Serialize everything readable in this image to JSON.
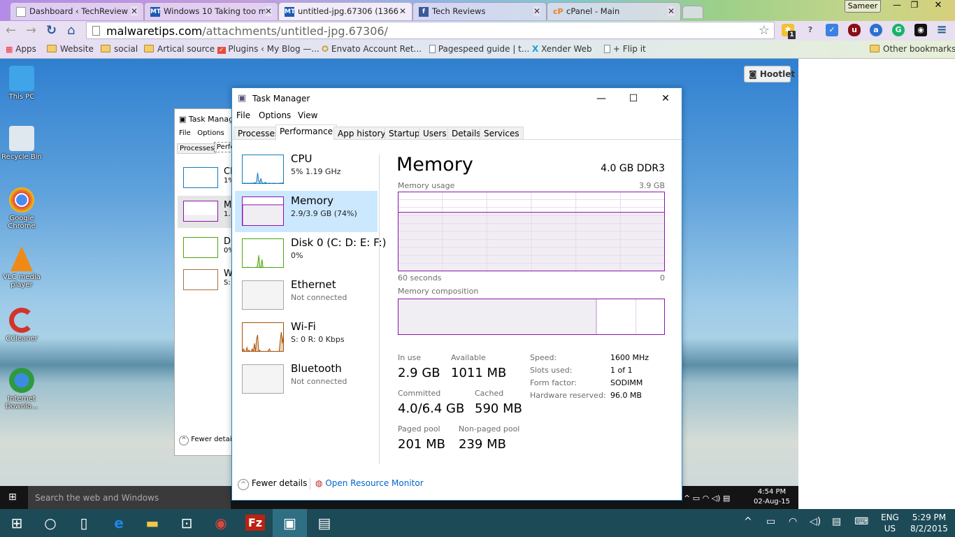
{
  "browser": {
    "tabs": [
      {
        "title": "Dashboard ‹ TechReview",
        "icon": "page-icon"
      },
      {
        "title": "Windows 10 Taking too m",
        "icon": "mt-icon",
        "favicon_text": "MT"
      },
      {
        "title": "untitled-jpg.67306 (1366×",
        "icon": "mt-icon",
        "favicon_text": "MT",
        "active": true
      },
      {
        "title": "Tech Reviews",
        "icon": "facebook-icon",
        "favicon_text": "f"
      },
      {
        "title": "cPanel - Main",
        "icon": "cpanel-icon",
        "favicon_text": "cP"
      }
    ],
    "user": "Sameer",
    "url_host": "malwaretips.com",
    "url_path": "/attachments/untitled-jpg.67306/",
    "extension_badge": "1",
    "bookmarks": [
      {
        "label": "Apps",
        "icon": "apps-grid-icon"
      },
      {
        "label": "Website",
        "icon": "folder-icon"
      },
      {
        "label": "social",
        "icon": "folder-icon"
      },
      {
        "label": "Artical source",
        "icon": "folder-icon"
      },
      {
        "label": "Plugins ‹ My Blog —...",
        "icon": "wordpress-check-icon"
      },
      {
        "label": "Envato Account Ret...",
        "icon": "envato-icon"
      },
      {
        "label": "Pagespeed guide | t...",
        "icon": "page-icon"
      },
      {
        "label": "Xender Web",
        "icon": "xender-icon"
      },
      {
        "label": "+ Flip it",
        "icon": "page-icon"
      }
    ],
    "other_bookmarks": "Other bookmarks"
  },
  "desktop": {
    "icons": [
      {
        "label": "This PC",
        "color": "#3fa4e8"
      },
      {
        "label": "Recycle Bin",
        "color": "#dfe8ef"
      },
      {
        "label": "Google Chrome",
        "color": "#e0443a"
      },
      {
        "label": "VLC media player",
        "color": "#f08a17"
      },
      {
        "label": "CCleaner",
        "color": "#d4332b"
      },
      {
        "label": "Internet Downlo...",
        "color": "#2d9b3d"
      }
    ],
    "hootlet": "Hootlet",
    "inner_search": "Search the web and Windows",
    "inner_time": "4:54 PM",
    "inner_date": "02-Aug-15"
  },
  "bg_task_manager": {
    "title": "Task Manage",
    "menu": [
      "File",
      "Options"
    ],
    "tabs": [
      "Processes",
      "Perfo"
    ],
    "items": [
      {
        "name": "Cl",
        "sub": "1%"
      },
      {
        "name": "M",
        "sub": "1."
      },
      {
        "name": "D",
        "sub": "0%"
      },
      {
        "name": "W",
        "sub": "S:"
      }
    ],
    "fewer": "Fewer detail"
  },
  "task_manager": {
    "title": "Task Manager",
    "menu": [
      "File",
      "Options",
      "View"
    ],
    "tabs": [
      "Processes",
      "Performance",
      "App history",
      "Startup",
      "Users",
      "Details",
      "Services"
    ],
    "active_tab": "Performance",
    "resources": [
      {
        "name": "CPU",
        "sub": "5%  1.19 GHz",
        "color": "#117dbb",
        "history": [
          2,
          2,
          3,
          2,
          2,
          3,
          2,
          2,
          3,
          2,
          3,
          4,
          3,
          8,
          40,
          10,
          4,
          20,
          5,
          3,
          2,
          6,
          3,
          2,
          2,
          3,
          2,
          2,
          2,
          3,
          2,
          2,
          2,
          2,
          2,
          3,
          2,
          4,
          2,
          2
        ]
      },
      {
        "name": "Memory",
        "sub": "2.9/3.9 GB (74%)",
        "color": "#8b12ae",
        "selected": true,
        "history": [
          74,
          74,
          74,
          74,
          74
        ]
      },
      {
        "name": "Disk 0 (C: D: E: F:)",
        "sub": "0%",
        "color": "#4da60c",
        "history": [
          0,
          0,
          2,
          0,
          0,
          3,
          0,
          0,
          0,
          0,
          0,
          0,
          2,
          0,
          10,
          45,
          5,
          0,
          30,
          0,
          0,
          0,
          0,
          0,
          0,
          0,
          2,
          0,
          0,
          0,
          0,
          0,
          0,
          0,
          0,
          0,
          0,
          0,
          0,
          5
        ]
      },
      {
        "name": "Ethernet",
        "sub": "Not connected",
        "color": "#a7a7a7",
        "history": []
      },
      {
        "name": "Wi-Fi",
        "sub": "S: 0  R: 0 Kbps",
        "color": "#a74f01",
        "history": [
          0,
          10,
          0,
          0,
          15,
          0,
          5,
          0,
          0,
          10,
          0,
          30,
          0,
          45,
          60,
          0,
          5,
          0,
          0,
          0,
          0,
          0,
          0,
          0,
          5,
          10,
          0,
          0,
          0,
          0,
          0,
          0,
          0,
          0,
          0,
          40,
          70,
          30,
          60,
          0
        ]
      },
      {
        "name": "Bluetooth",
        "sub": "Not connected",
        "color": "#a7a7a7",
        "history": []
      }
    ],
    "detail": {
      "title": "Memory",
      "spec": "4.0 GB DDR3",
      "usage_label": "Memory usage",
      "usage_max": "3.9 GB",
      "usage_percent": 74,
      "time_left": "60 seconds",
      "time_right": "0",
      "composition_label": "Memory composition",
      "composition_mb": {
        "in_use": 2970,
        "modified": 15,
        "standby": 590,
        "free": 421
      },
      "stats": [
        {
          "label": "In use",
          "value": "2.9 GB"
        },
        {
          "label": "Available",
          "value": "1011 MB"
        },
        {
          "label": "Committed",
          "value": "4.0/6.4 GB"
        },
        {
          "label": "Cached",
          "value": "590 MB"
        },
        {
          "label": "Paged pool",
          "value": "201 MB"
        },
        {
          "label": "Non-paged pool",
          "value": "239 MB"
        }
      ],
      "specs": [
        {
          "key": "Speed:",
          "value": "1600 MHz"
        },
        {
          "key": "Slots used:",
          "value": "1 of 1"
        },
        {
          "key": "Form factor:",
          "value": "SODIMM"
        },
        {
          "key": "Hardware reserved:",
          "value": "96.0 MB"
        }
      ]
    },
    "fewer_details": "Fewer details",
    "resource_monitor": "Open Resource Monitor"
  },
  "taskbar": {
    "apps": [
      "start",
      "cortana",
      "task-view",
      "edge",
      "file-explorer",
      "store",
      "chrome",
      "filezilla",
      "task-manager",
      "window-app"
    ],
    "lang": "ENG",
    "region": "US",
    "time": "5:29 PM",
    "date": "8/2/2015"
  }
}
